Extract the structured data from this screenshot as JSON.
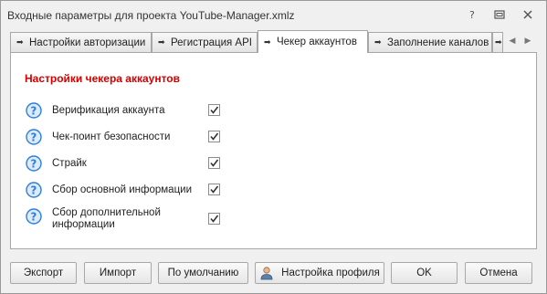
{
  "window": {
    "title": "Входные параметры для проекта YouTube-Manager.xmlz",
    "buttons": {
      "help": "help-icon",
      "maximize": "maximize-icon",
      "close": "close-icon"
    }
  },
  "tabs": [
    {
      "label": "Настройки авторизации",
      "active": false
    },
    {
      "label": "Регистрация API",
      "active": false
    },
    {
      "label": "Чекер аккаунтов",
      "active": true
    },
    {
      "label": "Заполнение каналов",
      "active": false
    },
    {
      "label": "",
      "active": false
    }
  ],
  "tab_arrow": "➡",
  "panel": {
    "section_title": "Настройки чекера аккаунтов",
    "options": [
      {
        "label": "Верификация аккаунта",
        "checked": true
      },
      {
        "label": "Чек-поинт безопасности",
        "checked": true
      },
      {
        "label": "Страйк",
        "checked": true
      },
      {
        "label": "Сбор основной информации",
        "checked": true
      },
      {
        "label": "Сбор дополнительной\nинформации",
        "checked": true
      }
    ]
  },
  "footer": {
    "export_label": "Экспорт",
    "import_label": "Импорт",
    "default_label": "По умолчанию",
    "profile_label": "Настройка профиля",
    "ok_label": "OK",
    "cancel_label": "Отмена"
  },
  "colors": {
    "section_title": "#d40000",
    "help_icon": "#2f7fd6"
  }
}
